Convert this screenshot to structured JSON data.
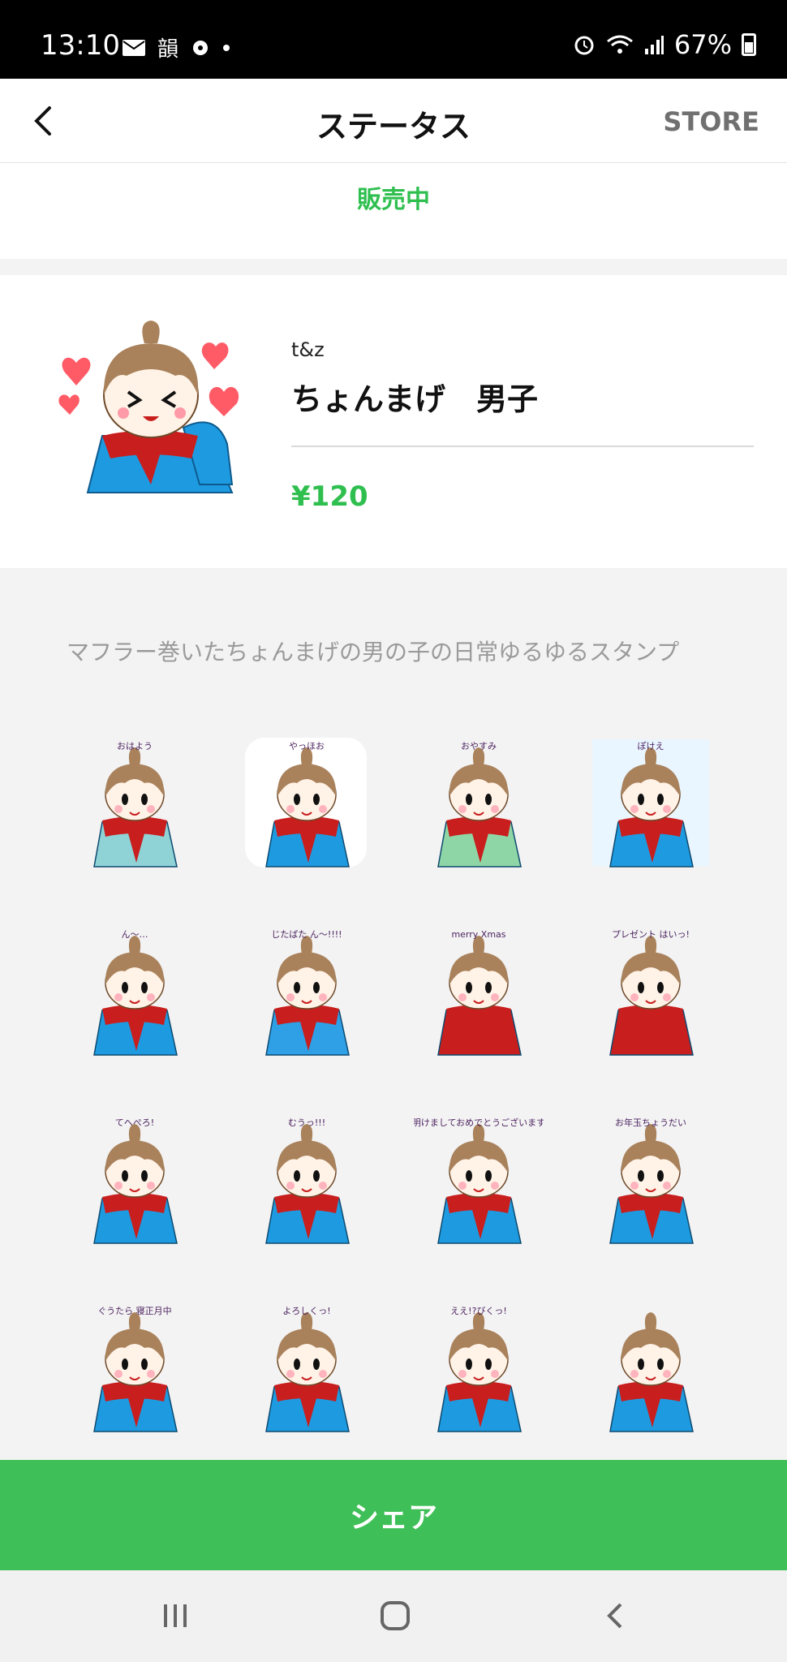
{
  "status_bar": {
    "time": "13:10",
    "left_text": "韻",
    "battery": "67%",
    "icons": [
      "mail-icon",
      "tv-icon",
      "dot-icon",
      "alarm-icon",
      "wifi-icon",
      "signal-icon",
      "battery-icon"
    ]
  },
  "header": {
    "title": "ステータス",
    "store": "STORE",
    "back_icon": "chevron-left-icon"
  },
  "sale": {
    "status": "販売中"
  },
  "product": {
    "author": "t&z",
    "title": "ちょんまげ　男子",
    "price": "¥120"
  },
  "description": "マフラー巻いたちょんまげの男の子の日常ゆるゆるスタンプ",
  "stickers": [
    {
      "id": "ohayo",
      "text": "おはよう",
      "scarf": "#c81e1e",
      "body": "#8fd3d6"
    },
    {
      "id": "yahho",
      "text": "やっほお",
      "scarf": "#c81e1e",
      "body": "#1e9be0"
    },
    {
      "id": "oyasumi",
      "text": "おやすみ",
      "scarf": "#c81e1e",
      "body": "#8fd6a6"
    },
    {
      "id": "pokee",
      "text": "ぽけえ",
      "scarf": "#c81e1e",
      "body": "#1e9be0"
    },
    {
      "id": "n",
      "text": "ん〜…",
      "scarf": "#c81e1e",
      "body": "#1e9be0"
    },
    {
      "id": "jitabata",
      "text": "じたばた ん〜!!!!",
      "scarf": "#c81e1e",
      "body": "#2f9fe6"
    },
    {
      "id": "merry-xmas",
      "text": "merry Xmas",
      "scarf": "#c81e1e",
      "body": "#c81e1e"
    },
    {
      "id": "present",
      "text": "プレゼント はいっ!",
      "scarf": "#c81e1e",
      "body": "#c81e1e"
    },
    {
      "id": "tehepero",
      "text": "てへぺろ!",
      "scarf": "#c81e1e",
      "body": "#1e9be0"
    },
    {
      "id": "muu",
      "text": "むうっ!!!",
      "scarf": "#c81e1e",
      "body": "#1e9be0"
    },
    {
      "id": "akemashite",
      "text": "明けましておめでとうございます",
      "scarf": "#c81e1e",
      "body": "#1e9be0"
    },
    {
      "id": "otoshidama",
      "text": "お年玉ちょうだい",
      "scarf": "#c81e1e",
      "body": "#1e9be0"
    },
    {
      "id": "nesho",
      "text": "ぐうたら 寝正月中",
      "scarf": "#c81e1e",
      "body": "#1e9be0"
    },
    {
      "id": "yoroshiku",
      "text": "よろしくっ!",
      "scarf": "#c81e1e",
      "body": "#1e9be0"
    },
    {
      "id": "ee",
      "text": "ええ!?びくっ!",
      "scarf": "#c81e1e",
      "body": "#1e9be0"
    },
    {
      "id": "cold",
      "text": "",
      "scarf": "#c81e1e",
      "body": "#1e9be0"
    }
  ],
  "share": {
    "label": "シェア"
  },
  "navbar": {
    "icons": [
      "recent-apps-icon",
      "home-icon",
      "back-icon"
    ]
  },
  "colors": {
    "accent": "#3fbf57",
    "hair": "#a9825c",
    "skin": "#fff2e6",
    "heart": "#ff5b67"
  }
}
